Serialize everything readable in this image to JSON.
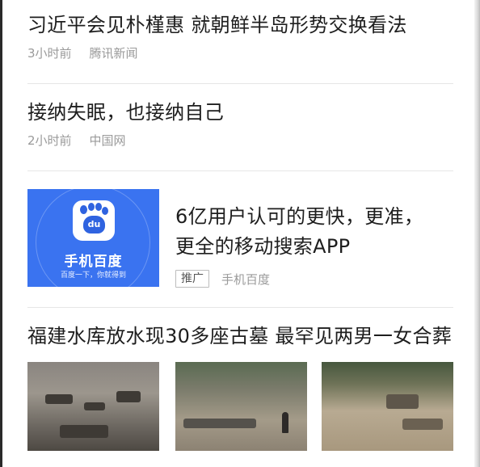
{
  "feed": {
    "items": [
      {
        "title": "习近平会见朴槿惠 就朝鲜半岛形势交换看法",
        "time": "3小时前",
        "source": "腾讯新闻"
      },
      {
        "title": "接纳失眠，也接纳自己",
        "time": "2小时前",
        "source": "中国网"
      },
      {
        "title_line1": "6亿用户认可的更快，更准，",
        "title_line2": "更全的移动搜索APP",
        "badge": "推广",
        "source": "手机百度",
        "thumb": {
          "logo_text": "du",
          "brand": "手机百度",
          "slogan": "百度一下，你就得到"
        }
      },
      {
        "title": "福建水库放水现30多座古墓 最罕见两男一女合葬",
        "photo_count": 3
      }
    ]
  },
  "colors": {
    "title": "#1e1e1e",
    "meta": "#9a9a9a",
    "divider": "#e6e6e6",
    "ad_blue": "#3a73f0"
  }
}
